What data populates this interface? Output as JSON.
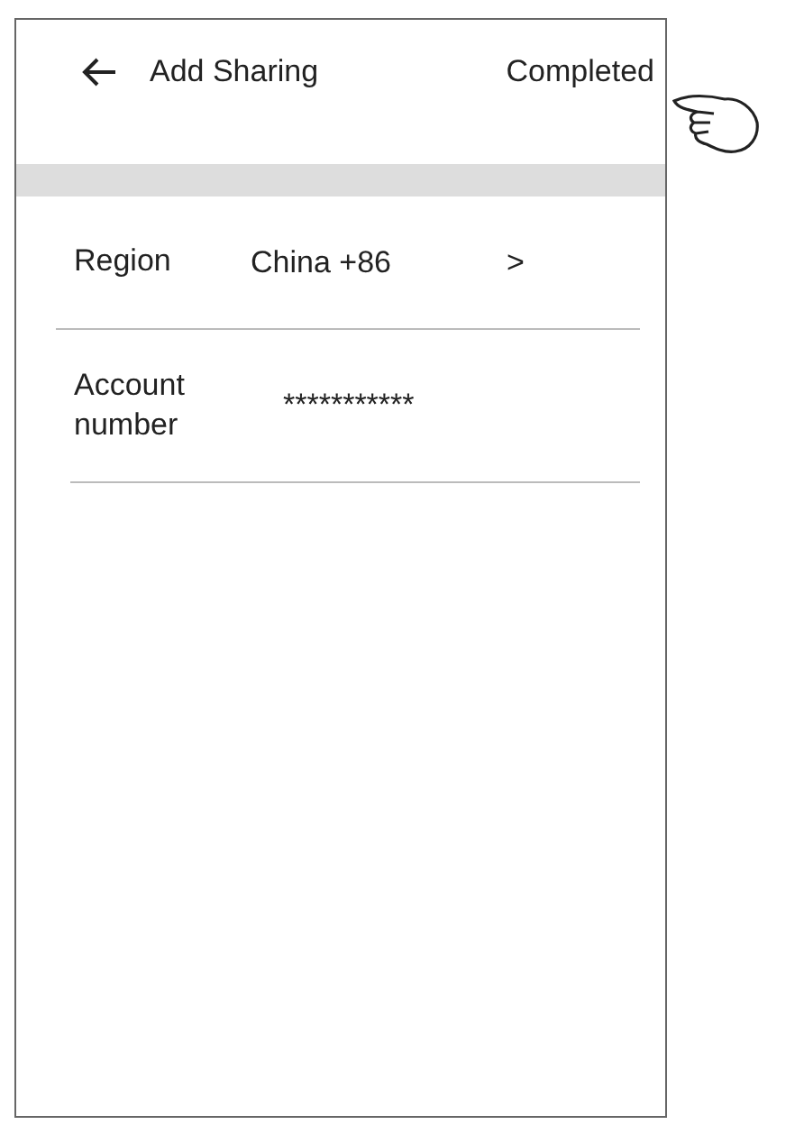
{
  "header": {
    "title": "Add Sharing",
    "action": "Completed"
  },
  "fields": [
    {
      "label": "Region",
      "value": "China +86",
      "chevron": ">"
    },
    {
      "label": "Account number",
      "value": "***********"
    }
  ]
}
